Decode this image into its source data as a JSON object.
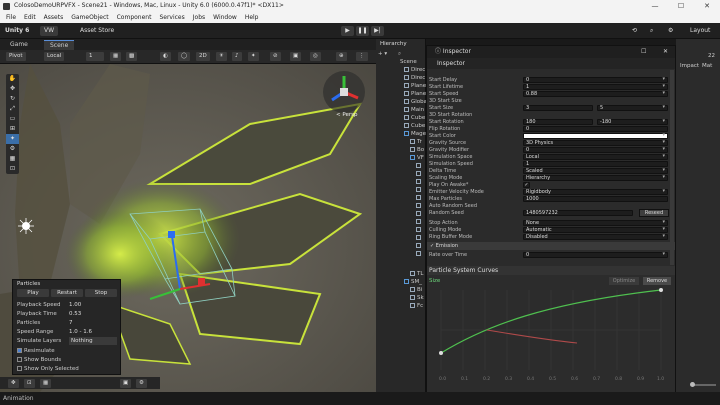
{
  "window": {
    "title": "ColosoDemoURPVFX - Scene21 - Windows, Mac, Linux - Unity 6.0 (6000.0.47f1)* <DX11>",
    "controls": [
      "—",
      "☐",
      "✕"
    ]
  },
  "menu": [
    "File",
    "Edit",
    "Assets",
    "GameObject",
    "Component",
    "Services",
    "Jobs",
    "Window",
    "Help"
  ],
  "toolbar": {
    "unity_label": "Unity 6",
    "account": "VW",
    "asset_store": "Asset Store",
    "layout": "Layout"
  },
  "scene_tabs": {
    "game": "Game",
    "scene": "Scene"
  },
  "scene_toolbar": {
    "pivot": "Pivot",
    "local": "Local",
    "grid_value": "1",
    "persp": "< Persp"
  },
  "particles_panel": {
    "title": "Particles",
    "buttons": [
      "Play",
      "Restart",
      "Stop"
    ],
    "rows": [
      {
        "label": "Playback Speed",
        "value": "1.00"
      },
      {
        "label": "Playback Time",
        "value": "0.53"
      },
      {
        "label": "Particles",
        "value": "7"
      },
      {
        "label": "Speed Range",
        "value": "1.0 - 1.6"
      },
      {
        "label": "Simulate Layers",
        "value": "Nothing"
      }
    ],
    "checks": [
      {
        "label": "Resimulate",
        "checked": true
      },
      {
        "label": "Show Bounds",
        "checked": false
      },
      {
        "label": "Show Only Selected",
        "checked": false
      }
    ]
  },
  "hierarchy": {
    "title": "Hierarchy",
    "items": [
      "Scene",
      "Direc",
      "Direc",
      "Plane",
      "Plane",
      "Globa",
      "Main",
      "Cube",
      "Cube",
      "Mage",
      "Tr",
      "Bo",
      "VF",
      "",
      "",
      "",
      "",
      "",
      "",
      "",
      "",
      "",
      "",
      "",
      "",
      "TL",
      "SM_",
      "Bi",
      "Sk",
      "Fc"
    ]
  },
  "inspector": {
    "title": "Inspector",
    "tab": "Inspector",
    "rows": [
      {
        "label": "Start Delay",
        "value": "0"
      },
      {
        "label": "Start Lifetime",
        "value": "1"
      },
      {
        "label": "Start Speed",
        "value": "0.88"
      },
      {
        "label": "3D Start Size",
        "value": ""
      },
      {
        "label": "Start Size",
        "value": "3",
        "value2": "5"
      },
      {
        "label": "3D Start Rotation",
        "value": ""
      },
      {
        "label": "Start Rotation",
        "value": "180",
        "value2": "-180"
      },
      {
        "label": "Flip Rotation",
        "value": "0"
      },
      {
        "label": "Start Color",
        "value": ""
      },
      {
        "label": "Gravity Source",
        "value": "3D Physics"
      },
      {
        "label": "Gravity Modifier",
        "value": "0"
      },
      {
        "label": "Simulation Space",
        "value": "Local"
      },
      {
        "label": "Simulation Speed",
        "value": "1"
      },
      {
        "label": "Delta Time",
        "value": "Scaled"
      },
      {
        "label": "Scaling Mode",
        "value": "Hierarchy"
      },
      {
        "label": "Play On Awake*",
        "value": "✓"
      },
      {
        "label": "Emitter Velocity Mode",
        "value": "Rigidbody"
      },
      {
        "label": "Max Particles",
        "value": "1000"
      },
      {
        "label": "Auto Random Seed",
        "value": ""
      },
      {
        "label": "Random Seed",
        "value": "1480597232"
      },
      {
        "label": "Stop Action",
        "value": "None"
      },
      {
        "label": "Culling Mode",
        "value": "Automatic"
      },
      {
        "label": "Ring Buffer Mode",
        "value": "Disabled"
      },
      {
        "label": "Emission",
        "value": ""
      },
      {
        "label": "Rate over Time",
        "value": "0"
      }
    ],
    "reseed": "Reseed",
    "curves_title": "Particle System Curves",
    "curve_label": "Size",
    "optimize": "Optimize",
    "remove": "Remove",
    "x_ticks": [
      "0.0",
      "0.1",
      "0.2",
      "0.3",
      "0.4",
      "0.5",
      "0.6",
      "0.7",
      "0.8",
      "0.9",
      "1.0"
    ]
  },
  "status": {
    "text": "Animation"
  },
  "right_panel": {
    "labels": [
      "Impact",
      "Mat",
      "22"
    ]
  }
}
